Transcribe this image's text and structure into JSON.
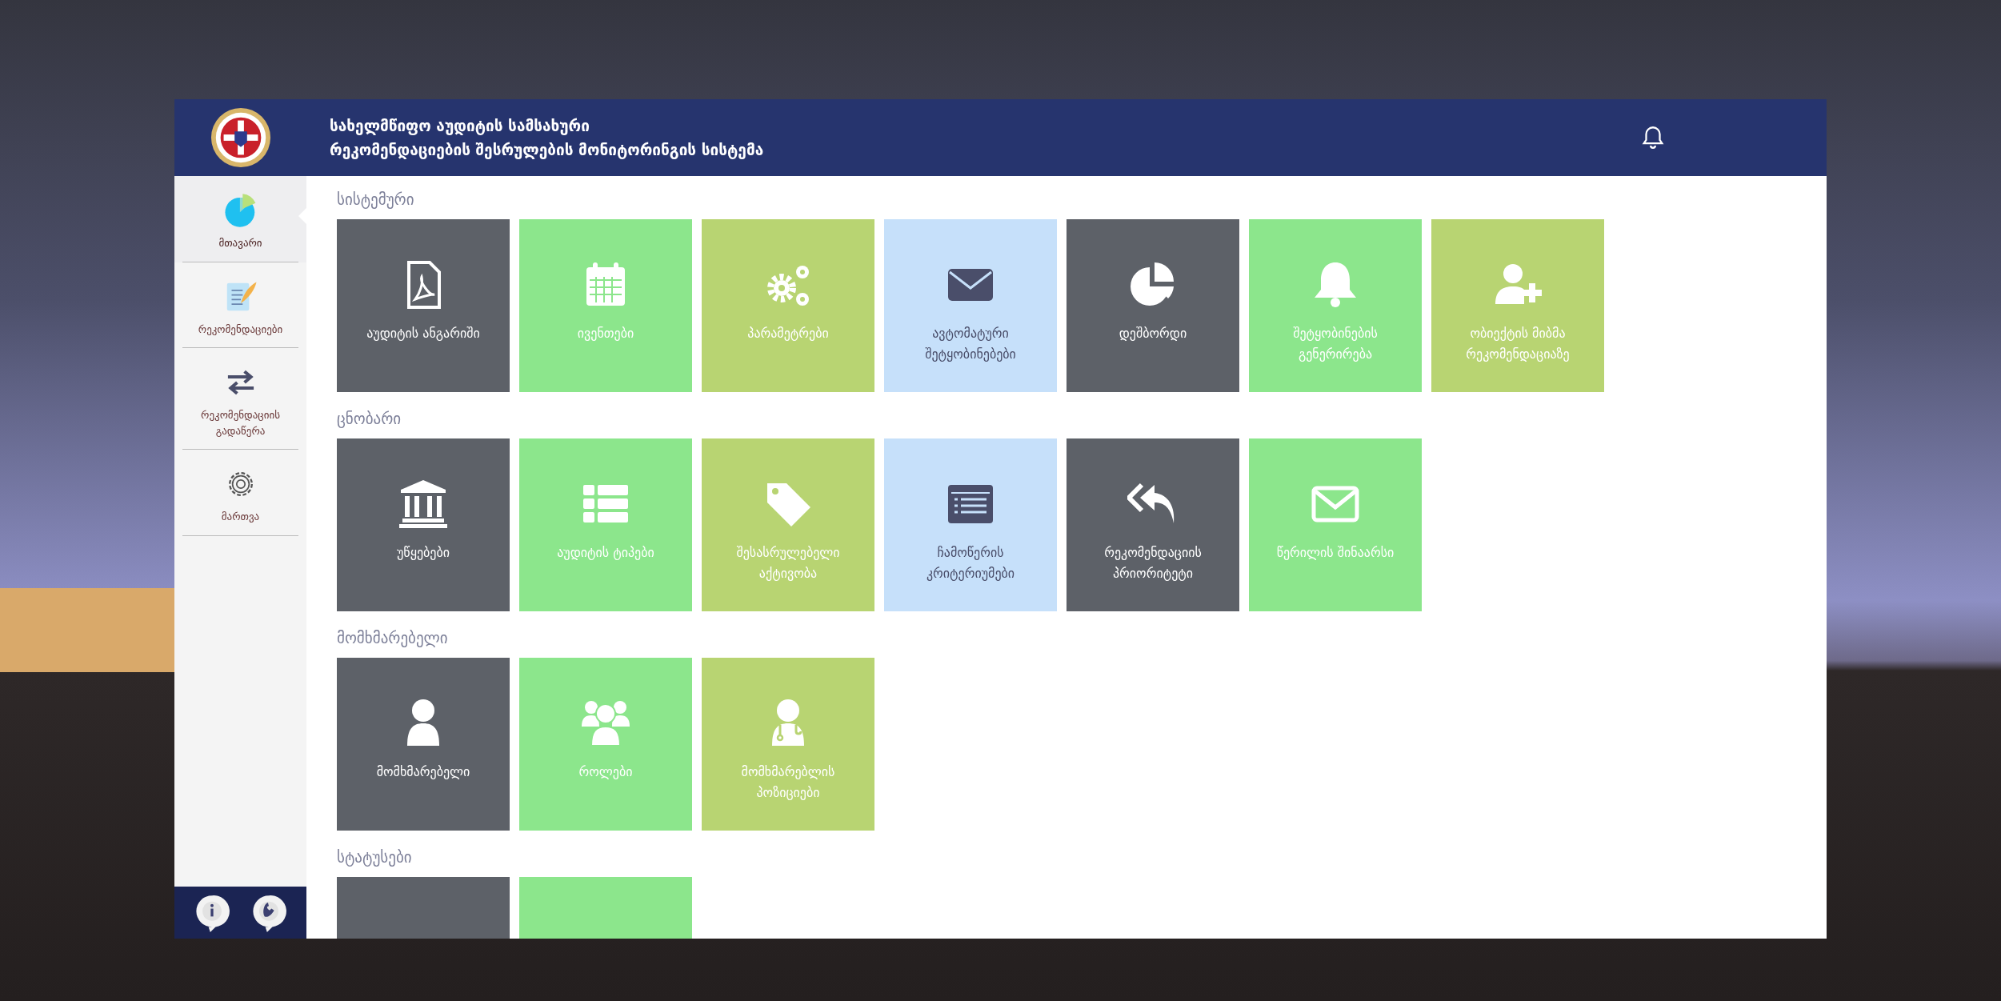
{
  "header": {
    "title": "სახელმწიფო აუდიტის სამსახური",
    "subtitle": "რეკომენდაციების შესრულების მონიტორინგის სისტემა"
  },
  "sidebar": {
    "items": [
      {
        "label": "მთავარი",
        "selected": true
      },
      {
        "label": "რეკომენდაციები",
        "selected": false
      },
      {
        "label": "რეკომენდაციის გადაწერა",
        "selected": false
      },
      {
        "label": "მართვა",
        "selected": false
      }
    ]
  },
  "sections": [
    {
      "title": "სისტემური",
      "tiles": [
        {
          "label": "აუდიტის ანგარიში",
          "color": "#5d6168"
        },
        {
          "label": "ივენთები",
          "color": "#8ce68c"
        },
        {
          "label": "პარამეტრები",
          "color": "#b8d472"
        },
        {
          "label": "ავტომატური შეტყობინებები",
          "color": "#c6e0fa"
        },
        {
          "label": "დეშბორდი",
          "color": "#5d6168"
        },
        {
          "label": "შეტყობინების გენერირება",
          "color": "#8ce68c"
        },
        {
          "label": "ობიექტის მიბმა რეკომენდაციაზე",
          "color": "#b8d472"
        }
      ]
    },
    {
      "title": "ცნობარი",
      "tiles": [
        {
          "label": "უწყებები",
          "color": "#5d6168"
        },
        {
          "label": "აუდიტის ტიპები",
          "color": "#8ce68c"
        },
        {
          "label": "შესასრულებელი აქტივობა",
          "color": "#b8d472"
        },
        {
          "label": "ჩამოწერის კრიტერიუმები",
          "color": "#c6e0fa"
        },
        {
          "label": "რეკომენდაციის პრიორიტეტი",
          "color": "#5d6168"
        },
        {
          "label": "წერილის შინაარსი",
          "color": "#8ce68c"
        }
      ]
    },
    {
      "title": "მომხმარებელი",
      "tiles": [
        {
          "label": "მომხმარებელი",
          "color": "#5d6168"
        },
        {
          "label": "როლები",
          "color": "#8ce68c"
        },
        {
          "label": "მომხმარებლის პოზიციები",
          "color": "#b8d472"
        }
      ]
    },
    {
      "title": "სტატუსები",
      "tiles": [
        {
          "color": "#5d6168"
        },
        {
          "color": "#8ce68c"
        }
      ]
    }
  ]
}
